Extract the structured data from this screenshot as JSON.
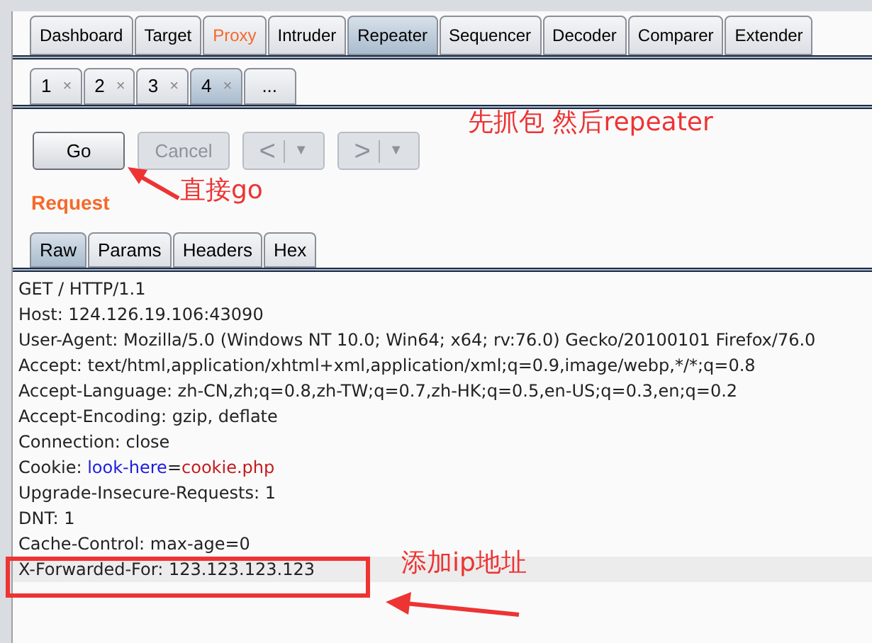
{
  "main_tabs": [
    {
      "label": "Dashboard",
      "selected": false,
      "alert": false
    },
    {
      "label": "Target",
      "selected": false,
      "alert": false
    },
    {
      "label": "Proxy",
      "selected": false,
      "alert": true
    },
    {
      "label": "Intruder",
      "selected": false,
      "alert": false
    },
    {
      "label": "Repeater",
      "selected": true,
      "alert": false
    },
    {
      "label": "Sequencer",
      "selected": false,
      "alert": false
    },
    {
      "label": "Decoder",
      "selected": false,
      "alert": false
    },
    {
      "label": "Comparer",
      "selected": false,
      "alert": false
    },
    {
      "label": "Extender",
      "selected": false,
      "alert": false
    }
  ],
  "repeater_tabs": [
    {
      "kind": "request",
      "label": "1",
      "close": "×",
      "selected": false
    },
    {
      "kind": "request",
      "label": "2",
      "close": "×",
      "selected": false
    },
    {
      "kind": "request",
      "label": "3",
      "close": "×",
      "selected": false
    },
    {
      "kind": "request",
      "label": "4",
      "close": "×",
      "selected": true
    },
    {
      "kind": "new",
      "label": "...",
      "selected": false
    }
  ],
  "buttons": [
    {
      "kind": "text",
      "label": "Go",
      "disabled": false
    },
    {
      "kind": "text",
      "label": "Cancel",
      "disabled": true
    },
    {
      "kind": "nav",
      "label": "<",
      "menu": "▼",
      "disabled": true
    },
    {
      "kind": "nav",
      "label": ">",
      "menu": "▼",
      "disabled": true
    }
  ],
  "request": {
    "title": "Request",
    "tabs": [
      {
        "label": "Raw",
        "selected": true
      },
      {
        "label": "Params",
        "selected": false
      },
      {
        "label": "Headers",
        "selected": false
      },
      {
        "label": "Hex",
        "selected": false
      }
    ],
    "lines": [
      {
        "selected": false,
        "segments": [
          {
            "kind": "plain",
            "text": "GET / HTTP/1.1"
          }
        ]
      },
      {
        "selected": false,
        "segments": [
          {
            "kind": "plain",
            "text": "Host: 124.126.19.106:43090"
          }
        ]
      },
      {
        "selected": false,
        "segments": [
          {
            "kind": "plain",
            "text": "User-Agent: Mozilla/5.0 (Windows NT 10.0; Win64; x64; rv:76.0) Gecko/20100101 Firefox/76.0"
          }
        ]
      },
      {
        "selected": false,
        "segments": [
          {
            "kind": "plain",
            "text": "Accept: text/html,application/xhtml+xml,application/xml;q=0.9,image/webp,*/*;q=0.8"
          }
        ]
      },
      {
        "selected": false,
        "segments": [
          {
            "kind": "plain",
            "text": "Accept-Language: zh-CN,zh;q=0.8,zh-TW;q=0.7,zh-HK;q=0.5,en-US;q=0.3,en;q=0.2"
          }
        ]
      },
      {
        "selected": false,
        "segments": [
          {
            "kind": "plain",
            "text": "Accept-Encoding: gzip, deflate"
          }
        ]
      },
      {
        "selected": false,
        "segments": [
          {
            "kind": "plain",
            "text": "Connection: close"
          }
        ]
      },
      {
        "selected": false,
        "segments": [
          {
            "kind": "plain",
            "text": "Cookie: "
          },
          {
            "kind": "param_name",
            "text": "look-here"
          },
          {
            "kind": "plain",
            "text": "="
          },
          {
            "kind": "param_value",
            "text": "cookie.php"
          }
        ]
      },
      {
        "selected": false,
        "segments": [
          {
            "kind": "plain",
            "text": "Upgrade-Insecure-Requests: 1"
          }
        ]
      },
      {
        "selected": false,
        "segments": [
          {
            "kind": "plain",
            "text": "DNT: 1"
          }
        ]
      },
      {
        "selected": false,
        "segments": [
          {
            "kind": "plain",
            "text": "Cache-Control: max-age=0"
          }
        ]
      },
      {
        "selected": true,
        "segments": [
          {
            "kind": "plain",
            "text": "X-Forwarded-For: 123.123.123.123"
          }
        ]
      }
    ]
  },
  "annotations": [
    {
      "kind": "note",
      "text": "先抓包 然后repeater"
    },
    {
      "kind": "arrow_note",
      "text": "直接go"
    },
    {
      "kind": "boxed_note",
      "text": "添加ip地址"
    }
  ]
}
